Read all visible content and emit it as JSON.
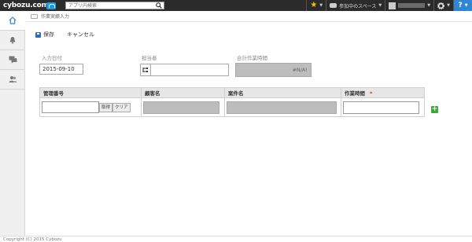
{
  "header": {
    "logo_text": "cybozu.com",
    "search_placeholder": "アプリ内検索",
    "spaces_label": "参加中のスペース",
    "help_label": "?"
  },
  "sidebar": {
    "items": [
      {
        "icon": "home-icon"
      },
      {
        "icon": "bell-icon"
      },
      {
        "icon": "message-icon"
      },
      {
        "icon": "people-icon"
      }
    ]
  },
  "breadcrumb": {
    "label": "作業実績入力"
  },
  "toolbar": {
    "save_label": "保存",
    "cancel_label": "キャンセル"
  },
  "form": {
    "date_label": "入力日付",
    "date_value": "2015-09-10",
    "assignee_label": "担当者",
    "total_time_label": "合計作業時間",
    "total_time_value": "#N/A!"
  },
  "subtable": {
    "columns": [
      "管理番号",
      "顧客名",
      "案件名",
      "作業時間"
    ],
    "required_mark": "*",
    "fetch_label": "取得",
    "clear_label": "クリア"
  },
  "footer": {
    "copyright": "Copyright (C) 2015 Cybozu"
  },
  "colors": {
    "topbar": "#2b2b2b",
    "accent": "#2e86d4",
    "add": "#3aaa35",
    "required": "#e21"
  }
}
